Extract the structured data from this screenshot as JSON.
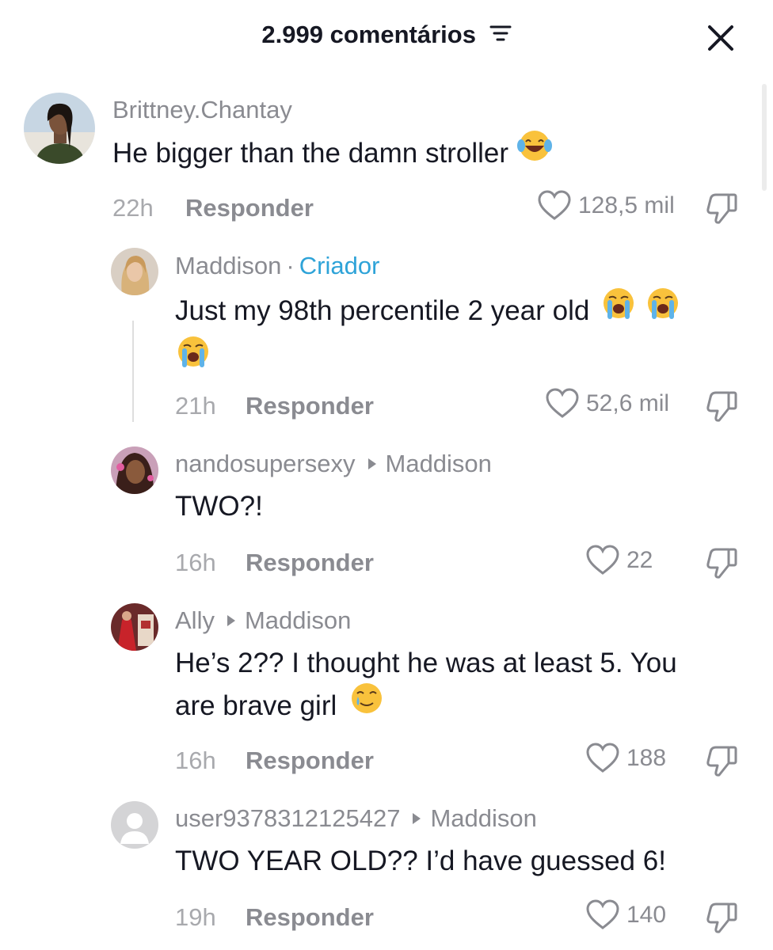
{
  "header": {
    "title": "2.999 comentários"
  },
  "icons": {
    "sort": "sort-lines-icon",
    "close": "close-x-icon",
    "like": "heart-outline-icon",
    "dislike": "thumbs-down-icon"
  },
  "colors": {
    "creator_accent": "#2ea3d8",
    "muted": "#8a8b91"
  },
  "comments": [
    {
      "username": "Brittney.Chantay",
      "text": "He bigger than the damn stroller",
      "emoji": "😂",
      "time": "22h",
      "reply_label": "Responder",
      "likes": "128,5 mil"
    },
    {
      "username": "Maddison",
      "separator": "·",
      "badge": "Criador",
      "text": "Just my 98th percentile 2 year old",
      "emoji": "😭",
      "time": "21h",
      "reply_label": "Responder",
      "likes": "52,6 mil"
    },
    {
      "username": "nandosupersexy",
      "reply_to": "Maddison",
      "text": "TWO?!",
      "time": "16h",
      "reply_label": "Responder",
      "likes": "22"
    },
    {
      "username": "Ally",
      "reply_to": "Maddison",
      "text_line1": "He’s 2?? I thought he was at least 5. You",
      "text_line2": "are brave girl",
      "emoji": "🥲",
      "time": "16h",
      "reply_label": "Responder",
      "likes": "188"
    },
    {
      "username": "user9378312125427",
      "reply_to": "Maddison",
      "text": "TWO YEAR OLD?? I’d have guessed 6!",
      "time": "19h",
      "reply_label": "Responder",
      "likes": "140"
    }
  ]
}
